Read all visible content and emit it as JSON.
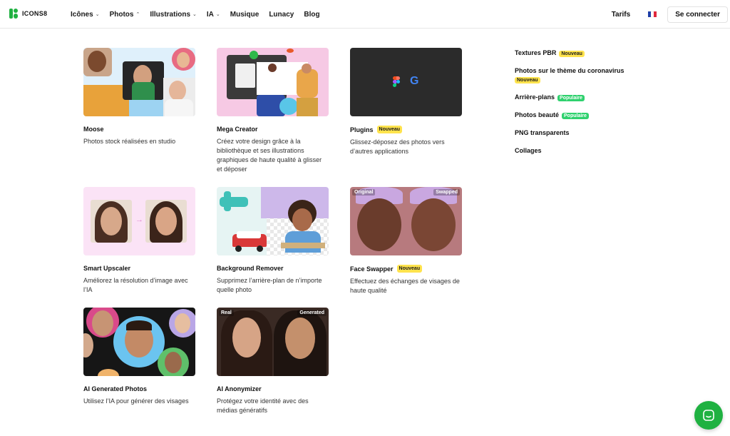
{
  "brand": {
    "name": "ICONS8",
    "accent": "#1fb141"
  },
  "nav": {
    "items": [
      {
        "label": "Icônes",
        "caret": "down"
      },
      {
        "label": "Photos",
        "caret": "up"
      },
      {
        "label": "Illustrations",
        "caret": "down"
      },
      {
        "label": "IA",
        "caret": "down"
      },
      {
        "label": "Musique",
        "caret": ""
      },
      {
        "label": "Lunacy",
        "caret": ""
      },
      {
        "label": "Blog",
        "caret": ""
      }
    ],
    "tarifs": "Tarifs",
    "language_flag": "french-flag",
    "login": "Se connecter"
  },
  "cards": [
    {
      "title": "Moose",
      "badge": "",
      "desc": "Photos stock réalisées en studio"
    },
    {
      "title": "Mega Creator",
      "badge": "",
      "desc": "Créez votre design grâce à la bibliothèque et ses illustrations graphiques de haute qualité à glisser et déposer"
    },
    {
      "title": "Plugins",
      "badge": "Nouveau",
      "desc": "Glissez-déposez des photos vers d’autres applications"
    },
    {
      "title": "Smart Upscaler",
      "badge": "",
      "desc": "Améliorez la résolution d’image avec l’IA"
    },
    {
      "title": "Background Remover",
      "badge": "",
      "desc": "Supprimez l’arrière-plan de n’importe quelle photo"
    },
    {
      "title": "Face Swapper",
      "badge": "Nouveau",
      "desc": "Effectuez des échanges de visages de haute qualité",
      "tag_left": "Original",
      "tag_right": "Swapped"
    },
    {
      "title": "AI Generated Photos",
      "badge": "",
      "desc": "Utilisez l’IA pour générer des visages"
    },
    {
      "title": "AI Anonymizer",
      "badge": "",
      "desc": "Protégez votre identité avec des médias génératifs",
      "tag_left": "Real",
      "tag_right": "Generated"
    }
  ],
  "sidebar": {
    "items": [
      {
        "label": "Textures PBR",
        "badge": "Nouveau",
        "badge_type": "new"
      },
      {
        "label": "Photos sur le thème du coronavirus",
        "badge": "Nouveau",
        "badge_type": "new"
      },
      {
        "label": "Arrière-plans",
        "badge": "Populaire",
        "badge_type": "popular"
      },
      {
        "label": "Photos beauté",
        "badge": "Populaire",
        "badge_type": "popular"
      },
      {
        "label": "PNG transparents",
        "badge": "",
        "badge_type": ""
      },
      {
        "label": "Collages",
        "badge": "",
        "badge_type": ""
      }
    ]
  },
  "colors": {
    "badge_new": "#ffe34d",
    "badge_popular": "#2fd16e",
    "chat": "#1fb141"
  },
  "chat": {
    "icon": "chat-icon"
  }
}
